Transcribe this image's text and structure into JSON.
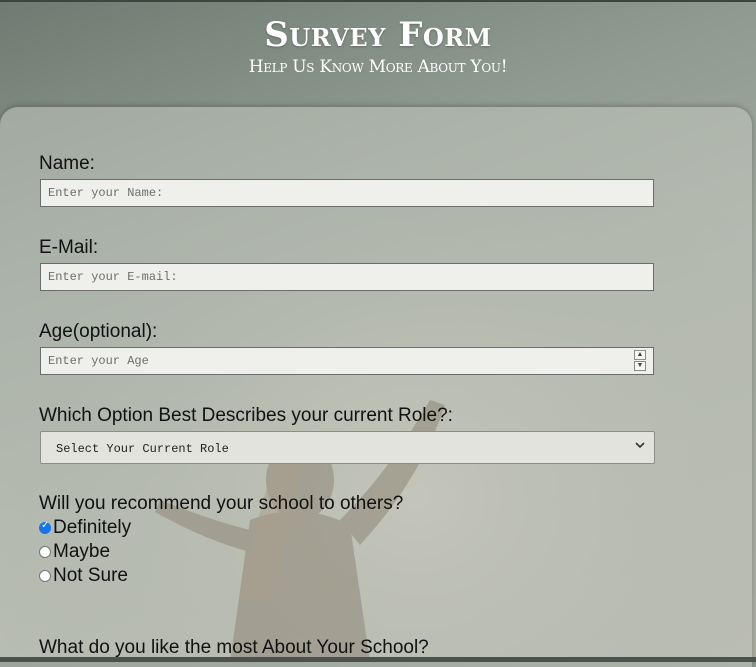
{
  "header": {
    "title": "Survey Form",
    "subtitle": "Help Us Know More About You!"
  },
  "form": {
    "name_label": "Name:",
    "name_placeholder": "Enter your Name:",
    "email_label": "E-Mail:",
    "email_placeholder": "Enter your E-mail:",
    "age_label": "Age(optional):",
    "age_placeholder": "Enter your Age",
    "role_label": "Which Option Best Describes your current Role?:",
    "role_selected": "Select Your Current Role",
    "recommend_label": "Will you recommend your school to others?",
    "recommend_options": [
      {
        "label": "Definitely",
        "checked": true
      },
      {
        "label": "Maybe",
        "checked": false
      },
      {
        "label": "Not Sure",
        "checked": false
      }
    ],
    "like_label": "What do you like the most About Your School?"
  },
  "icons": {
    "select_arrow": "chevron-down-icon",
    "spin_up": "chevron-up-icon",
    "spin_down": "chevron-down-icon"
  },
  "colors": {
    "radio_checked": "#1a73e8",
    "title_text": "#ffffff"
  }
}
